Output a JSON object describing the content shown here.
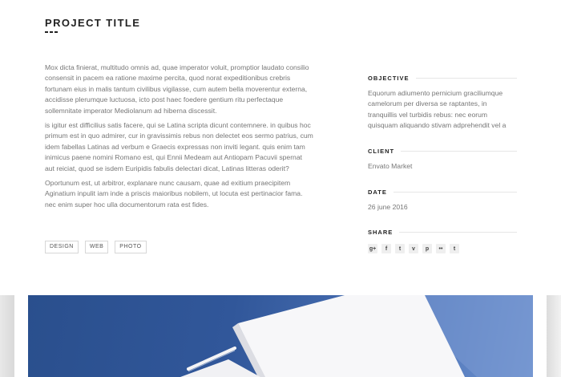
{
  "project": {
    "title": "PROJECT TITLE",
    "paragraphs": [
      "Mox dicta finierat, multitudo omnis ad, quae imperator voluit, promptior laudato consilio consensit in pacem ea ratione maxime percita, quod norat expeditionibus crebris fortunam eius in malis tantum civilibus vigilasse, cum autem bella moverentur externa, accidisse plerumque luctuosa, icto post haec foedere gentium ritu perfectaque sollemnitate imperator Mediolanum ad hiberna discessit.",
      "is igitur est difficilius satis facere, qui se Latina scripta dicunt contemnere. in quibus hoc primum est in quo admirer, cur in gravissimis rebus non delectet eos sermo patrius, cum idem fabellas Latinas ad verbum e Graecis expressas non inviti legant. quis enim tam inimicus paene nomini Romano est, qui Ennii Medeam aut Antiopam Pacuvii spernat aut reiciat, quod se isdem Euripidis fabulis delectari dicat, Latinas litteras oderit?",
      "Oportunum est, ut arbitror, explanare nunc causam, quae ad exitium praecipitem Aginatium inpulit iam inde a priscis maioribus nobilem, ut locuta est pertinacior fama. nec enim super hoc ulla documentorum rata est fides."
    ],
    "tags": [
      "DESIGN",
      "WEB",
      "PHOTO"
    ]
  },
  "sidebar": {
    "objective": {
      "label": "OBJECTIVE",
      "text": "Equorum adiumento pernicium graciliumque camelorum per diversa se raptantes, in tranquillis vel turbidis rebus: nec eorum quisquam aliquando stivam adprehendit vel a"
    },
    "client": {
      "label": "CLIENT",
      "text": "Envato Market"
    },
    "date": {
      "label": "DATE",
      "text": "26 june 2016"
    },
    "share": {
      "label": "SHARE",
      "icons": [
        {
          "name": "google-plus-icon",
          "glyph": "g+"
        },
        {
          "name": "facebook-icon",
          "glyph": "f"
        },
        {
          "name": "twitter-icon",
          "glyph": "t"
        },
        {
          "name": "vimeo-icon",
          "glyph": "v"
        },
        {
          "name": "pinterest-icon",
          "glyph": "p"
        },
        {
          "name": "flickr-icon",
          "glyph": "••"
        },
        {
          "name": "tumblr-icon",
          "glyph": "t"
        }
      ]
    }
  },
  "colors": {
    "gallery_blue": "#31579a",
    "paper_white": "#f7f7f9"
  }
}
